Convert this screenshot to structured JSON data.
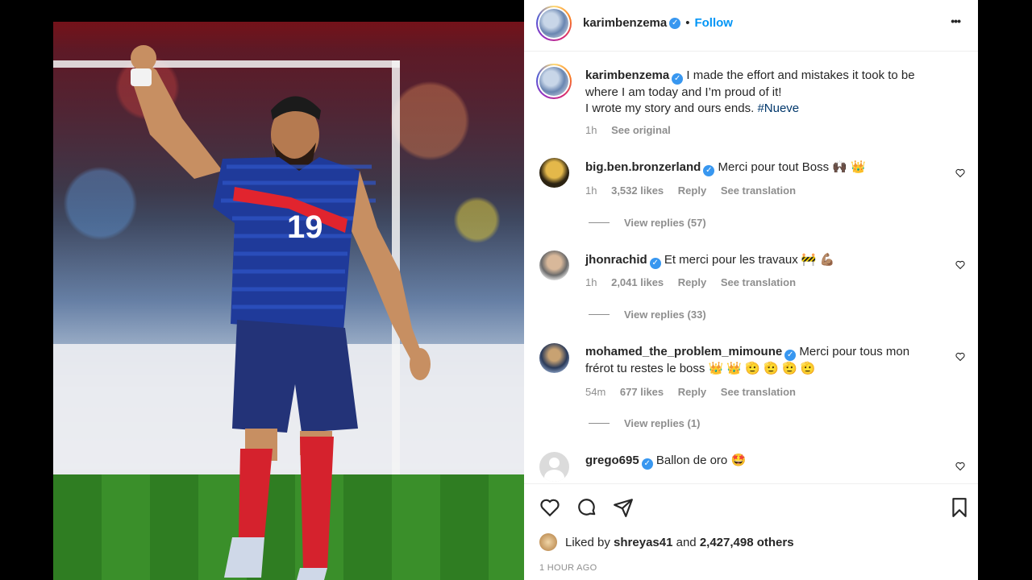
{
  "post": {
    "author": "karimbenzema",
    "follow_label": "Follow",
    "more_label": "•••",
    "caption_line1": "I made the effort and mistakes it took to be",
    "caption_line2": "where I am today and I’m proud of it!",
    "caption_line3": "I wrote my story and ours ends.",
    "hashtag": "#Nueve",
    "caption_time": "1h",
    "see_original": "See original"
  },
  "comments": [
    {
      "user": "big.ben.bronzerland",
      "text": "Merci pour tout Boss 🙌🏿 👑",
      "time": "1h",
      "likes": "3,532 likes",
      "reply": "Reply",
      "translate": "See translation",
      "view_replies": "View replies (57)"
    },
    {
      "user": "jhonrachid",
      "text": "Et merci pour les travaux 🚧 💪🏽",
      "time": "1h",
      "likes": "2,041 likes",
      "reply": "Reply",
      "translate": "See translation",
      "view_replies": "View replies (33)"
    },
    {
      "user": "mohamed_the_problem_mimoune",
      "text": "Merci pour tous mon",
      "text2": "frérot tu restes le boss 👑 👑 🫡 🫡 🫡 🫡",
      "time": "54m",
      "likes": "677 likes",
      "reply": "Reply",
      "translate": "See translation",
      "view_replies": "View replies (1)"
    },
    {
      "user": "grego695",
      "text": "Ballon de oro 🤩"
    }
  ],
  "footer": {
    "liked_by_prefix": "Liked by",
    "liked_by_user": "shreyas41",
    "liked_by_and": "and",
    "liked_by_count": "2,427,498 others",
    "timestamp": "1 HOUR AGO"
  },
  "photo": {
    "jersey_number": "19"
  }
}
